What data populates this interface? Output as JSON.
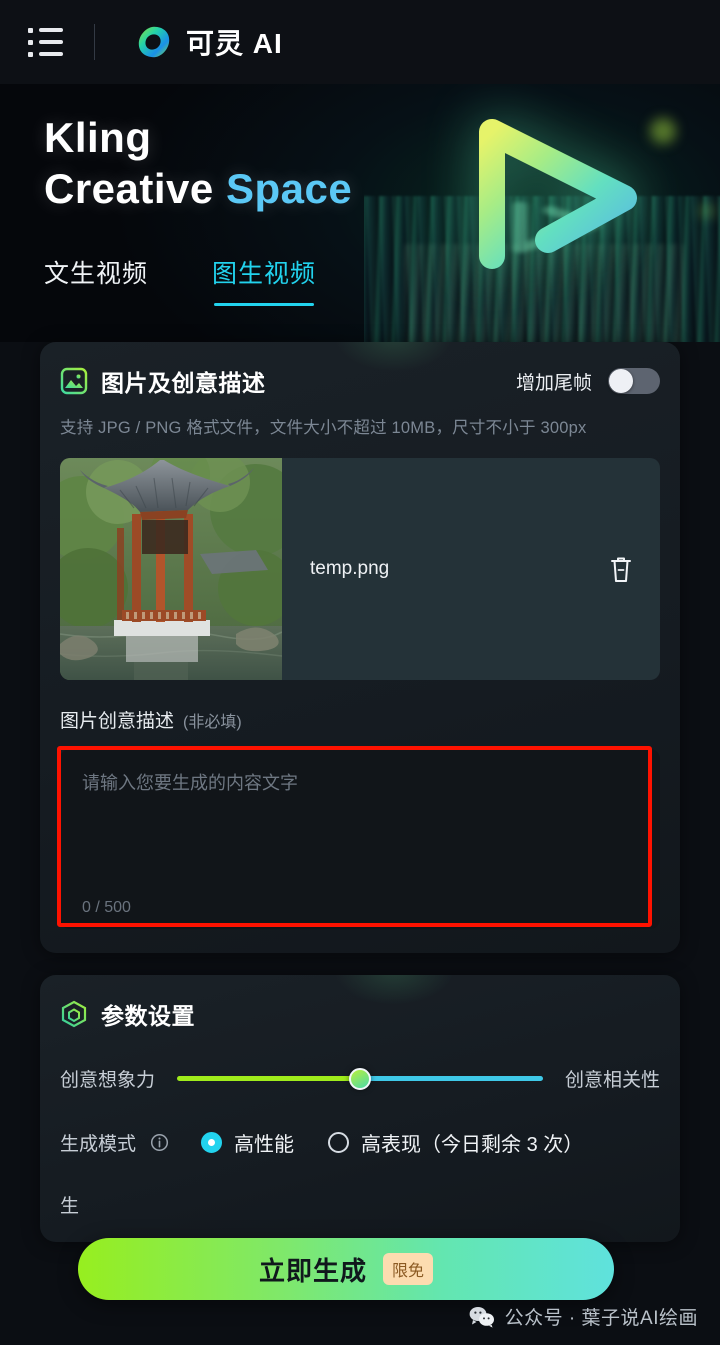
{
  "header": {
    "menu_icon": "list-menu-icon",
    "logo_icon": "kling-logo-icon",
    "brand_name": "可灵 AI"
  },
  "hero": {
    "line1": "Kling",
    "line2_part1": "Creative ",
    "line2_accent": "Space",
    "accent_color": "#5bc8f5",
    "art_icon": "glowing-play-triangle-graphic"
  },
  "tabs": [
    {
      "label": "文生视频",
      "active": false
    },
    {
      "label": "图生视频",
      "active": true
    }
  ],
  "image_section": {
    "icon": "image-picture-icon",
    "title": "图片及创意描述",
    "tail_frame_label": "增加尾帧",
    "tail_frame_on": false,
    "hint": "支持 JPG / PNG 格式文件，文件大小不超过 10MB，尺寸不小于 300px",
    "file": {
      "thumbnail_alt": "chinese-garden-pavilion-photo",
      "name": "temp.png",
      "delete_icon": "trash-icon"
    },
    "prompt_label": "图片创意描述",
    "prompt_optional": "(非必填)",
    "prompt_placeholder": "请输入您要生成的内容文字",
    "prompt_value": "",
    "counter": "0 / 500"
  },
  "params_section": {
    "icon": "hexagon-settings-icon",
    "title": "参数设置",
    "slider": {
      "left_label": "创意想象力",
      "right_label": "创意相关性",
      "value_percent": 50,
      "left_color": "#a0ec1b",
      "right_color": "#3fc9e8"
    },
    "mode": {
      "label": "生成模式",
      "info_icon": "info-circle-icon",
      "options": [
        {
          "label": "高性能",
          "selected": true
        },
        {
          "label": "高表现（今日剩余 3 次）",
          "selected": false
        }
      ]
    },
    "obscured_row_label": "生"
  },
  "generate_button": {
    "label": "立即生成",
    "badge": "限免"
  },
  "watermark": {
    "icon": "wechat-icon",
    "text": "公众号 · 葉子说AI绘画"
  }
}
